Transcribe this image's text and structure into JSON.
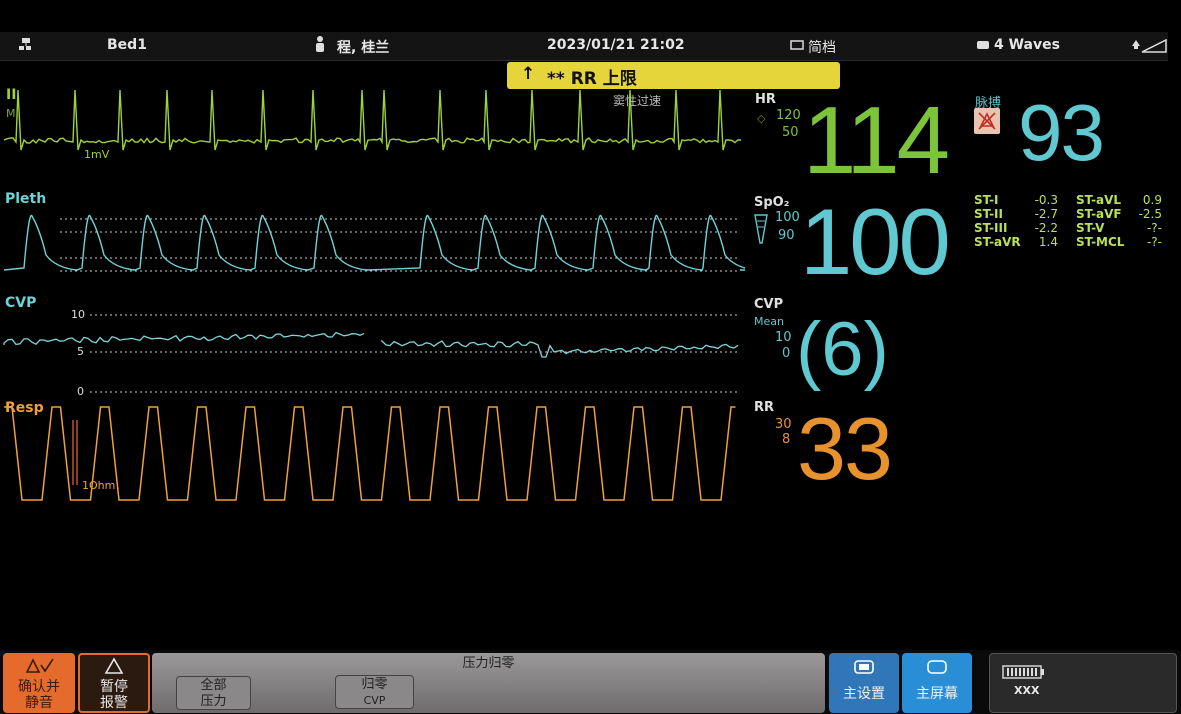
{
  "header": {
    "bed": "Bed1",
    "patient": "程, 桂兰",
    "datetime": "2023/01/21  21:02",
    "profile": "简档",
    "waves": "4 Waves"
  },
  "alarm": {
    "arrow": "↑",
    "text": "** RR   上限",
    "subtext": "窦性过速"
  },
  "waves": {
    "ecg": {
      "label": "II",
      "sub": "M",
      "scale": "1mV",
      "color": "#9ed23c"
    },
    "pleth": {
      "label": "Pleth",
      "color": "#6fd3d8"
    },
    "cvp": {
      "label": "CVP",
      "scale_hi": "10",
      "scale_mid": "5",
      "scale_lo": "0",
      "color": "#7fd5d9"
    },
    "resp": {
      "label": "Resp",
      "scale": "1Ohm",
      "color": "#f0a03a"
    }
  },
  "params": {
    "hr": {
      "label": "HR",
      "hi": "120",
      "lo": "50",
      "value": "114"
    },
    "pulse": {
      "label": "脉搏",
      "value": "93"
    },
    "spo2": {
      "label": "SpO₂",
      "hi": "100",
      "lo": "90",
      "value": "100"
    },
    "cvp": {
      "label": "CVP",
      "sub": "Mean",
      "hi": "10",
      "lo": "0",
      "value": "(6)"
    },
    "rr": {
      "label": "RR",
      "hi": "30",
      "lo": "8",
      "value": "33"
    }
  },
  "st": [
    {
      "name": "ST-I",
      "value": "-0.3"
    },
    {
      "name": "ST-II",
      "value": "-2.7"
    },
    {
      "name": "ST-III",
      "value": "-2.2"
    },
    {
      "name": "ST-aVR",
      "value": "1.4"
    },
    {
      "name": "ST-aVL",
      "value": "0.9"
    },
    {
      "name": "ST-aVF",
      "value": "-2.5"
    },
    {
      "name": "ST-V",
      "value": "-?-"
    },
    {
      "name": "ST-MCL",
      "value": "-?-"
    }
  ],
  "footer": {
    "ack_line1": "确认并",
    "ack_line2": "静音",
    "pause_line1": "暂停",
    "pause_line2": "报警",
    "zero_title": "压力归零",
    "all_line1": "全部",
    "all_line2": "压力",
    "zero_line1": "归零",
    "zero_line2": "CVP",
    "main_setup": "主设置",
    "main_screen": "主屏幕",
    "device": "XXX"
  },
  "colors": {
    "green": "#7cc43a",
    "cyan": "#5fc8d0",
    "orange": "#e8922e",
    "alarm_yellow": "#e6d53a",
    "ack_orange": "#e46b2c",
    "button_blue": "#2a8ed6"
  }
}
